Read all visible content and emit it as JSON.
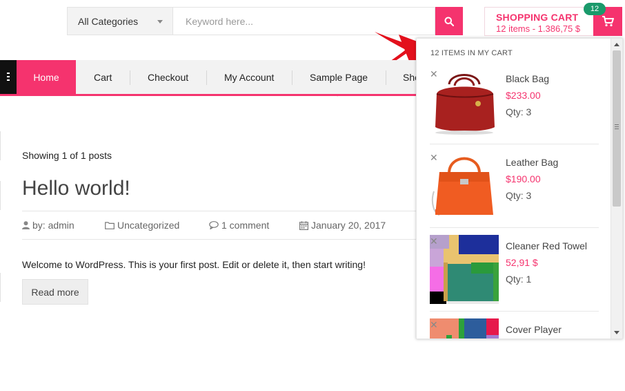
{
  "search": {
    "category_label": "All Categories",
    "placeholder": "Keyword here...",
    "button_icon": "search-icon"
  },
  "cart": {
    "title": "SHOPPING CART",
    "summary": "12 items - 1.386,75 $",
    "badge": "12",
    "icon": "cart-icon"
  },
  "nav": {
    "menu_icon": "hamburger-icon",
    "items": [
      {
        "label": "Home"
      },
      {
        "label": "Cart"
      },
      {
        "label": "Checkout"
      },
      {
        "label": "My Account"
      },
      {
        "label": "Sample Page"
      },
      {
        "label": "Sho"
      }
    ]
  },
  "post": {
    "showing": "Showing 1 of 1 posts",
    "title": "Hello world!",
    "author": "by: admin",
    "category": "Uncategorized",
    "comments": "1 comment",
    "date": "January 20, 2017",
    "excerpt": "Welcome to WordPress. This is your first post. Edit or delete it, then start writing!",
    "read_more": "Read more"
  },
  "mini_cart": {
    "heading": "12 ITEMS IN MY CART",
    "items": [
      {
        "name": "Black Bag",
        "price": "$233.00",
        "qty": "Qty: 3"
      },
      {
        "name": "Leather Bag",
        "price": "$190.00",
        "qty": "Qty: 3"
      },
      {
        "name": "Cleaner Red Towel",
        "price": "52,91 $",
        "qty": "Qty: 1"
      },
      {
        "name": "Cover Player",
        "price": "",
        "qty": ""
      }
    ]
  },
  "colors": {
    "accent": "#f5336e",
    "badge": "#1a9a6b",
    "nav_bg": "#f2f2f2"
  }
}
